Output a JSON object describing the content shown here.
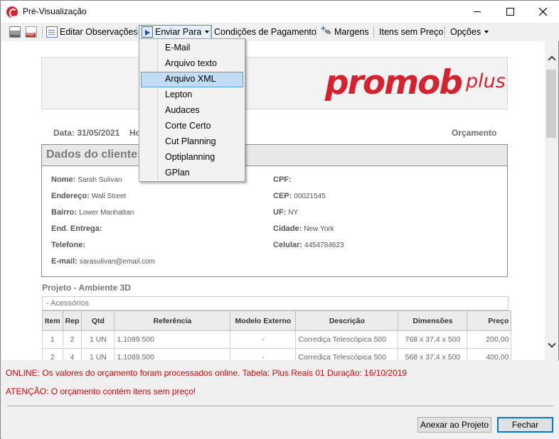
{
  "window": {
    "title": "Pré-Visualização"
  },
  "toolbar": {
    "edit_notes": "Editar Observações",
    "send_to": "Enviar Para",
    "payment_terms": "Condições de Pagamento",
    "margins": "Margens",
    "unpriced_items": "Itens sem Preço",
    "options": "Opções"
  },
  "send_menu": {
    "items": [
      "E-Mail",
      "Arquivo texto",
      "Arquivo XML",
      "Lepton",
      "Audaces",
      "Corte Certo",
      "Cut Planning",
      "Optiplanning",
      "GPlan"
    ],
    "selected": "Arquivo XML"
  },
  "report": {
    "logo_main": "promob",
    "logo_sub": "plus",
    "date_label": "Data: 31/05/2021",
    "hora_label": "Ho",
    "budget_label": "Orçamento",
    "client_section_title": "Dados do cliente:",
    "client": {
      "nome_label": "Nome:",
      "nome": "Sarah Sulivan",
      "endereco_label": "Endereço:",
      "endereco": "Wall Street",
      "bairro_label": "Bairro:",
      "bairro": "Lower Manhattan",
      "entrega_label": "End. Entrega:",
      "entrega": "",
      "telefone_label": "Telefone:",
      "telefone": "",
      "email_label": "E-mail:",
      "email": "sarasulivan@email.com",
      "cpf_label": "CPF:",
      "cpf": "",
      "cep_label": "CEP:",
      "cep": "00021545",
      "uf_label": "UF:",
      "uf": "NY",
      "cidade_label": "Cidade:",
      "cidade": "New York",
      "celular_label": "Celular:",
      "celular": "4454784623"
    },
    "project_title": "Projeto - Ambiente 3D",
    "accessories_label": "- Acessórios",
    "table": {
      "headers": [
        "Item",
        "Rep",
        "Qtd",
        "Referência",
        "Modelo Externo",
        "Descrição",
        "Dimensões",
        "Preço"
      ],
      "rows": [
        [
          "1",
          "2",
          "1 UN",
          "1.1089.500",
          "-",
          "Corrediça Telescópica 500",
          "768 x 37,4 x 500",
          "200,00"
        ],
        [
          "2",
          "4",
          "1 UN",
          "1.1089.500",
          "-",
          "Corrediça Telescópica 500",
          "568 x 37,4 x 500",
          "400,00"
        ]
      ]
    }
  },
  "status": {
    "online": "ONLINE: Os valores do orçamento foram processados online. Tabela:  Plus Reais 01 Duração: 16/10/2019",
    "warning": "ATENÇÃO: O orçamento contém itens sem preço!"
  },
  "buttons": {
    "attach": "Anexar ao Projeto",
    "close": "Fechar"
  },
  "colors": {
    "brand_red": "#d4232f",
    "status_red": "#e00000",
    "selection_blue": "#c1dcf3"
  }
}
